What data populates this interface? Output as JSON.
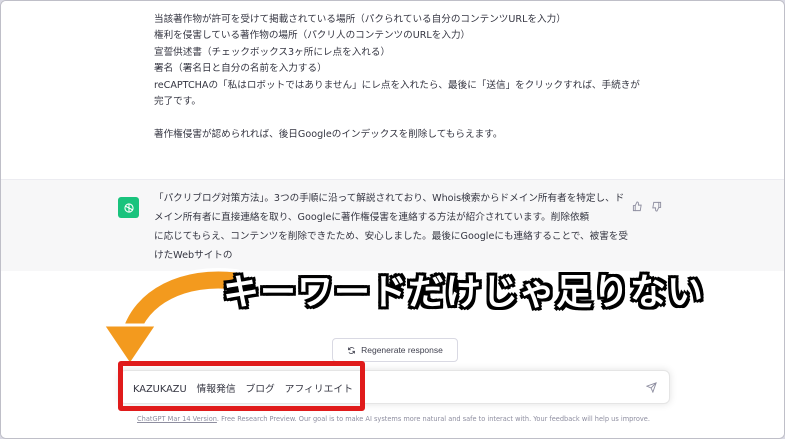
{
  "user_message": {
    "lines": [
      "当該著作物が許可を受けて掲載されている場所（パクられている自分のコンテンツURLを入力）",
      "権利を侵害している著作物の場所（パクリ人のコンテンツのURLを入力）",
      "宣誓供述書（チェックボックス3ヶ所にレ点を入れる）",
      "署名（署名日と自分の名前を入力する）",
      "reCAPTCHAの「私はロボットではありません」にレ点を入れたら、最後に「送信」をクリックすれば、手続きが",
      "完了です。",
      "",
      "著作権侵害が認められれば、後日Googleのインデックスを削除してもらえます。"
    ]
  },
  "bot_message": {
    "lines": [
      "「パクリブログ対策方法」。3つの手順に沿って解説されており、Whois検索からドメイン所有者を特定し、ド",
      "メイン所有者に直接連絡を取り、Googleに著作権侵害を連絡する方法が紹介されています。削除依頼",
      "に応じてもらえ、コンテンツを削除できたため、安心しました。最後にGoogleにも連絡することで、被害を受",
      "けたWebサイトの"
    ],
    "avatar_icon": "openai-logo-icon",
    "accent_color": "#19c37d"
  },
  "overlay": {
    "caption": "キーワードだけじゃ足りない",
    "arrow_color": "#f39a1e",
    "highlight_color": "#e01b1b"
  },
  "controls": {
    "regenerate_label": "Regenerate response",
    "input_value": "KAZUKAZU　情報発信　ブログ　アフィリエイト"
  },
  "footer": {
    "link": "ChatGPT Mar 14 Version",
    "text": ". Free Research Preview. Our goal is to make AI systems more natural and safe to interact with. Your feedback will help us improve."
  }
}
